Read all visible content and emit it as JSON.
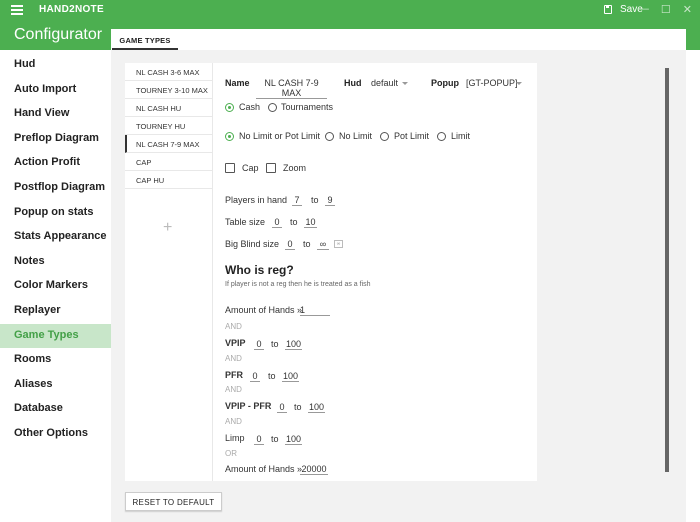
{
  "app": {
    "title": "HAND2NOTE",
    "save_label": "Save"
  },
  "window_controls": {
    "minimize": "—",
    "maximize": "☐",
    "close": "✕"
  },
  "sidebar": {
    "title": "Configurator",
    "items": [
      {
        "label": "Hud"
      },
      {
        "label": "Auto Import"
      },
      {
        "label": "Hand View"
      },
      {
        "label": "Preflop Diagram"
      },
      {
        "label": "Action Profit"
      },
      {
        "label": "Postflop Diagram"
      },
      {
        "label": "Popup on stats"
      },
      {
        "label": "Stats Appearance"
      },
      {
        "label": "Notes"
      },
      {
        "label": "Color Markers"
      },
      {
        "label": "Replayer"
      },
      {
        "label": "Game Types"
      },
      {
        "label": "Rooms"
      },
      {
        "label": "Aliases"
      },
      {
        "label": "Database"
      },
      {
        "label": "Other Options"
      }
    ],
    "active_index": 11
  },
  "tabs": [
    {
      "label": "GAME TYPES"
    }
  ],
  "game_types": {
    "items": [
      "NL CASH 3-6 MAX",
      "TOURNEY 3-10 MAX",
      "NL CASH HU",
      "TOURNEY HU",
      "NL CASH 7-9 MAX",
      "CAP",
      "CAP HU"
    ],
    "selected_index": 4,
    "add_label": "+"
  },
  "form": {
    "name_label": "Name",
    "name_value": "NL CASH 7-9 MAX",
    "hud_label": "Hud",
    "hud_value": "default",
    "popup_label": "Popup",
    "popup_value": "[GT-POPUP]",
    "game_mode": {
      "cash": "Cash",
      "tournaments": "Tournaments",
      "selected": "cash"
    },
    "limit": {
      "nl_pl": "No Limit or Pot Limit",
      "nl": "No Limit",
      "pl": "Pot Limit",
      "fl": "Limit",
      "selected": "nl_pl"
    },
    "cap_label": "Cap",
    "zoom_label": "Zoom",
    "players_in_hand": {
      "label": "Players in hand",
      "from": "7",
      "to_label": "to",
      "to": "9"
    },
    "table_size": {
      "label": "Table size",
      "from": "0",
      "to_label": "to",
      "to": "10"
    },
    "big_blind": {
      "label": "Big Blind size",
      "from": "0",
      "to_label": "to",
      "to": "∞",
      "inf_box": "∞"
    },
    "reg": {
      "heading": "Who is reg?",
      "subtitle": "If player is not a reg then he is treated as a fish",
      "amount1_label": "Amount of Hands »",
      "amount1_value": "1",
      "and1": "AND",
      "vpip": {
        "label": "VPIP",
        "from": "0",
        "to_label": "to",
        "to": "100"
      },
      "and2": "AND",
      "pfr": {
        "label": "PFR",
        "from": "0",
        "to_label": "to",
        "to": "100"
      },
      "and3": "AND",
      "vpip_pfr": {
        "label": "VPIP - PFR",
        "from": "0",
        "to_label": "to",
        "to": "100"
      },
      "and4": "AND",
      "limp": {
        "label": "Limp",
        "from": "0",
        "to_label": "to",
        "to": "100"
      },
      "or": "OR",
      "amount2_label": "Amount of Hands »",
      "amount2_value": "20000"
    }
  },
  "reset_label": "RESET TO DEFAULT",
  "colors": {
    "accent": "#4caf50",
    "active_bg": "#c8e6c9"
  }
}
